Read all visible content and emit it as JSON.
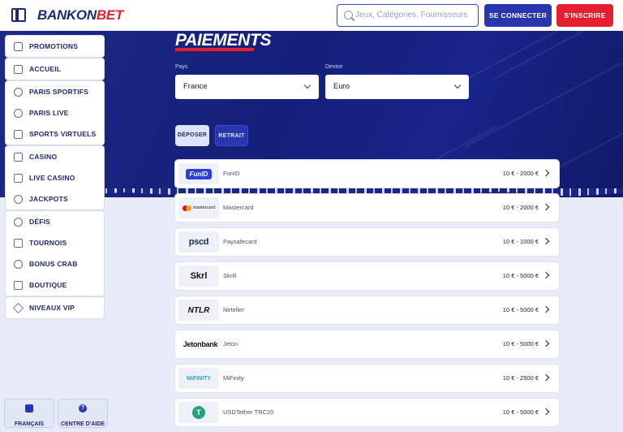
{
  "header": {
    "logo_part1": "BANKON",
    "logo_part2": "BET",
    "search_placeholder": "Jeux, Catégories, Fournisseurs",
    "login_label": "SE CONNECTER",
    "signup_label": "S'INSCRIRE"
  },
  "sidebar": {
    "groups": [
      [
        {
          "label": "PROMOTIONS",
          "icon": "gift-icon"
        }
      ],
      [
        {
          "label": "ACCUEIL",
          "icon": "home-icon"
        }
      ],
      [
        {
          "label": "PARIS SPORTIFS",
          "icon": "ball-icon"
        },
        {
          "label": "PARIS LIVE",
          "icon": "live-icon"
        },
        {
          "label": "SPORTS VIRTUELS",
          "icon": "virtual-icon"
        }
      ],
      [
        {
          "label": "CASINO",
          "icon": "chip-icon"
        },
        {
          "label": "LIVE CASINO",
          "icon": "dealer-icon"
        },
        {
          "label": "JACKPOTS",
          "icon": "jackpot-icon"
        }
      ],
      [
        {
          "label": "DÉFIS",
          "icon": "medal-icon"
        },
        {
          "label": "TOURNOIS",
          "icon": "trophy-icon"
        },
        {
          "label": "BONUS CRAB",
          "icon": "crab-icon"
        },
        {
          "label": "BOUTIQUE",
          "icon": "shop-icon"
        }
      ],
      [
        {
          "label": "NIVEAUX VIP",
          "icon": "diamond-icon"
        }
      ]
    ]
  },
  "footer": {
    "language_label": "FRANÇAIS",
    "help_label": "CENTRE D'AIDE",
    "help_glyph": "?"
  },
  "main": {
    "title": "PAIEMENTS",
    "country_label": "Pays",
    "country_value": "France",
    "currency_label": "Devise",
    "currency_value": "Euro",
    "tab_deposit": "DÉPOSER",
    "tab_withdraw": "RETRAIT",
    "methods": [
      {
        "logo": "FunID",
        "name": "FunID",
        "range": "10 € - 2000 €"
      },
      {
        "logo": "mastercard",
        "name": "Mastercard",
        "range": "10 € - 2000 €"
      },
      {
        "logo": "pscd",
        "name": "Paysafecard",
        "range": "10 € - 1000 €"
      },
      {
        "logo": "Skrl",
        "name": "Skrill",
        "range": "10 € - 5000 €"
      },
      {
        "logo": "NTLR",
        "name": "Neteller",
        "range": "10 € - 5000 €"
      },
      {
        "logo": "Jetonbank",
        "name": "Jeton",
        "range": "10 € - 5000 €"
      },
      {
        "logo": "MiFINITY",
        "name": "MiFinity",
        "range": "10 € - 2500 €"
      },
      {
        "logo": "T",
        "name": "USDTether TRC20",
        "range": "10 € - 5000 €"
      }
    ]
  },
  "colors": {
    "brand_navy": "#1d2a73",
    "brand_red": "#e51f2f",
    "primary_blue": "#2836b0"
  }
}
